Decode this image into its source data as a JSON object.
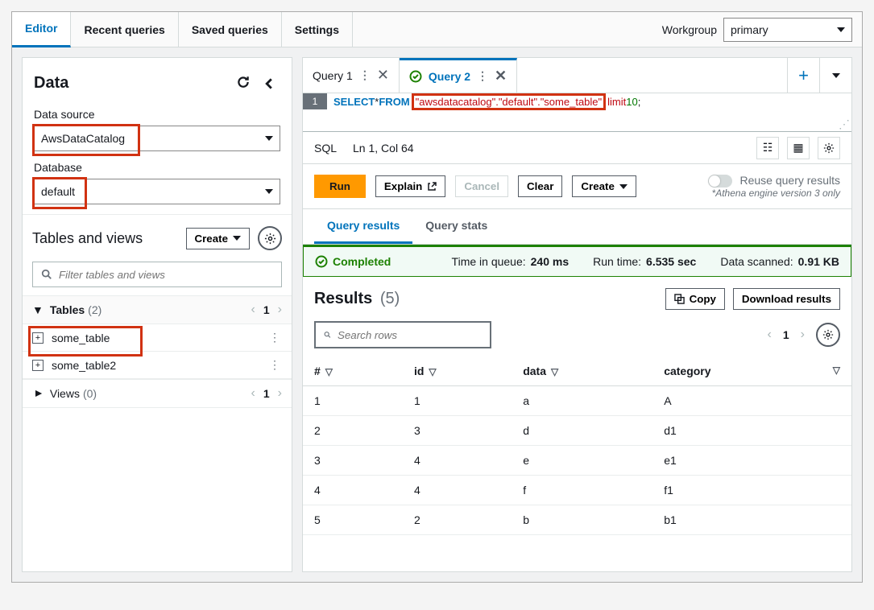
{
  "nav": {
    "tabs": [
      "Editor",
      "Recent queries",
      "Saved queries",
      "Settings"
    ],
    "active": 0,
    "workgroup_label": "Workgroup",
    "workgroup_value": "primary"
  },
  "sidebar": {
    "title": "Data",
    "data_source_label": "Data source",
    "data_source_value": "AwsDataCatalog",
    "database_label": "Database",
    "database_value": "default",
    "tv_title": "Tables and views",
    "tv_create": "Create",
    "filter_placeholder": "Filter tables and views",
    "tables_label": "Tables",
    "tables_count": "(2)",
    "tables_page": "1",
    "tables": [
      "some_table",
      "some_table2"
    ],
    "views_label": "Views",
    "views_count": "(0)",
    "views_page": "1"
  },
  "query_tabs": {
    "tab1": "Query 1",
    "tab2": "Query 2"
  },
  "editor": {
    "line_no": "1",
    "kw_select": "SELECT",
    "star": " * ",
    "kw_from": "FROM",
    "str_path": "\"awsdatacatalog\".\"default\".\"some_table\"",
    "kw_limit": "limit",
    "num": " 10",
    "semi": ";"
  },
  "statusbar": {
    "lang": "SQL",
    "pos": "Ln 1, Col 64"
  },
  "buttons": {
    "run": "Run",
    "explain": "Explain",
    "cancel": "Cancel",
    "clear": "Clear",
    "create": "Create",
    "reuse": "Reuse query results",
    "note": "*Athena engine version 3 only"
  },
  "result_tabs": {
    "results": "Query results",
    "stats": "Query stats"
  },
  "completed": {
    "status": "Completed",
    "queue_label": "Time in queue:",
    "queue_value": "240 ms",
    "runtime_label": "Run time:",
    "runtime_value": "6.535 sec",
    "scan_label": "Data scanned:",
    "scan_value": "0.91 KB"
  },
  "results": {
    "title": "Results",
    "count": "(5)",
    "copy": "Copy",
    "download": "Download results",
    "search_placeholder": "Search rows",
    "page": "1",
    "columns": [
      "#",
      "id",
      "data",
      "category"
    ],
    "rows": [
      {
        "n": "1",
        "id": "1",
        "data": "a",
        "cat": "A"
      },
      {
        "n": "2",
        "id": "3",
        "data": "d",
        "cat": "d1"
      },
      {
        "n": "3",
        "id": "4",
        "data": "e",
        "cat": "e1"
      },
      {
        "n": "4",
        "id": "4",
        "data": "f",
        "cat": "f1"
      },
      {
        "n": "5",
        "id": "2",
        "data": "b",
        "cat": "b1"
      }
    ]
  }
}
